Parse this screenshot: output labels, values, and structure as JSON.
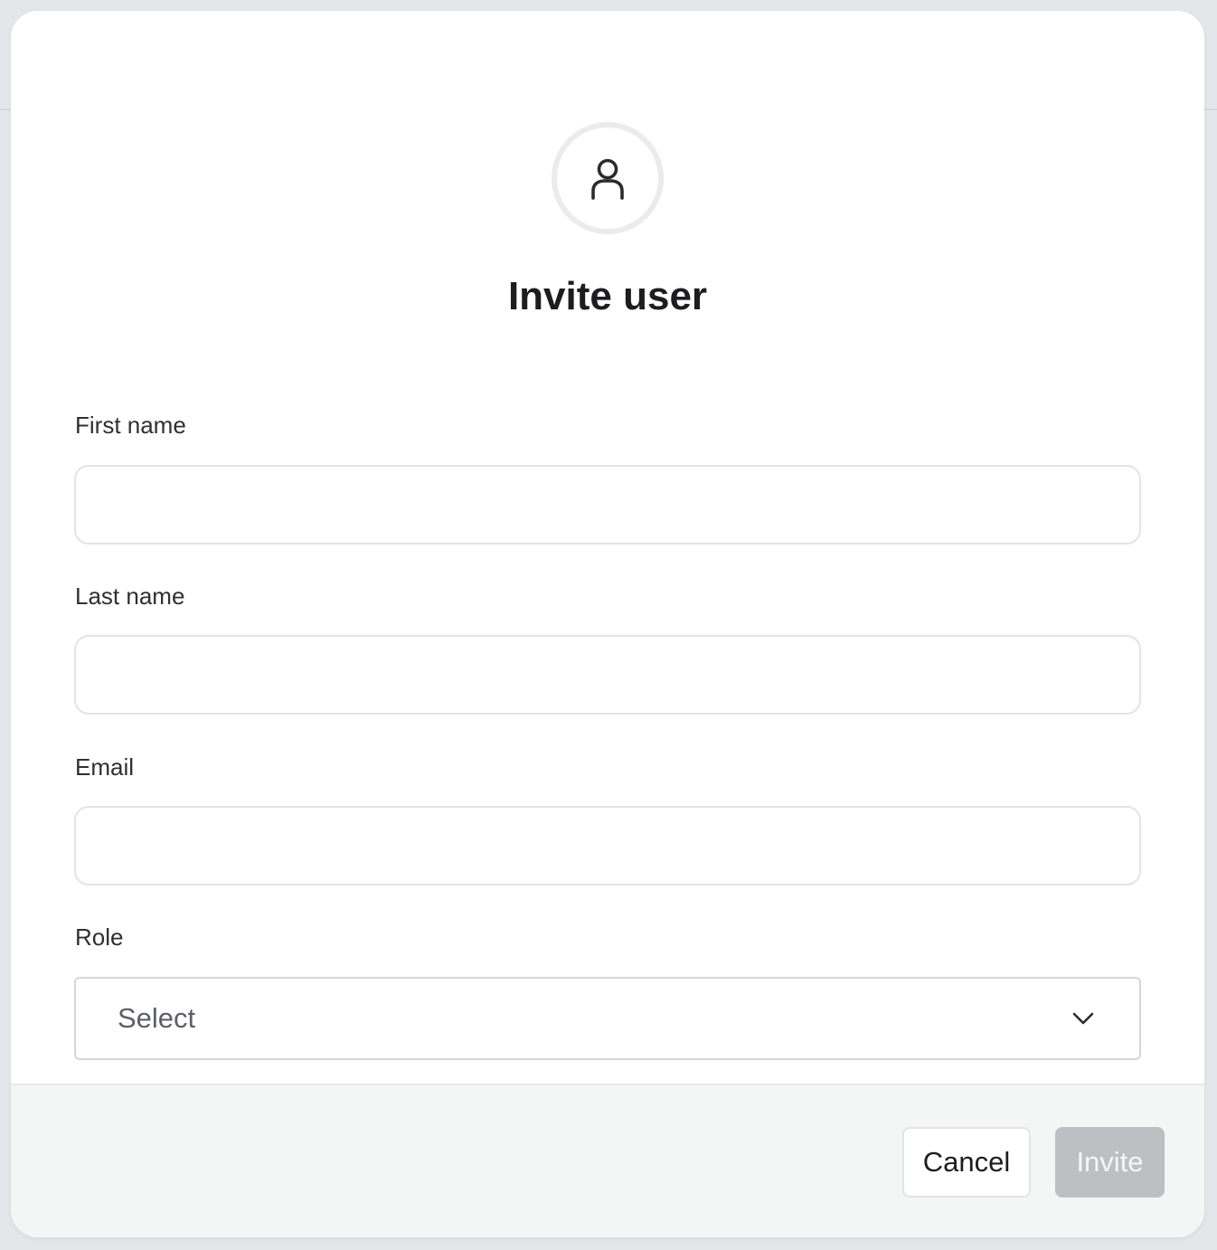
{
  "dialog": {
    "title": "Invite user",
    "avatar_icon": "user-icon"
  },
  "form": {
    "first_name": {
      "label": "First name",
      "value": "",
      "placeholder": ""
    },
    "last_name": {
      "label": "Last name",
      "value": "",
      "placeholder": ""
    },
    "email": {
      "label": "Email",
      "value": "",
      "placeholder": ""
    },
    "role": {
      "label": "Role",
      "selected": "Select",
      "icon": "chevron-down-icon"
    }
  },
  "footer": {
    "cancel_label": "Cancel",
    "invite_label": "Invite",
    "invite_disabled": true
  },
  "colors": {
    "title": "#1d1d1f",
    "invite_button_disabled": "#bdbfc3",
    "footer_background": "#f4f5f5"
  }
}
